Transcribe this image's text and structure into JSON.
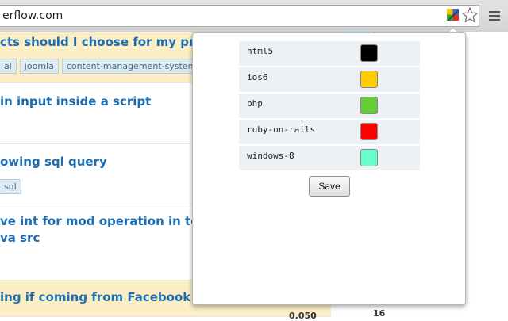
{
  "browser": {
    "url": "erflow.com"
  },
  "questions": [
    {
      "title": "cts should I choose for my proje",
      "tags": [
        "al",
        "joomla",
        "content-management-system"
      ]
    },
    {
      "title": "in input inside a script",
      "tags": []
    },
    {
      "title": "owing sql query",
      "tags": [
        "sql"
      ]
    },
    {
      "title_lines": [
        "ve int for mod operation in toSt",
        "va src"
      ],
      "tags": []
    },
    {
      "title": "ing if coming from Facebook",
      "meta": "0.050"
    }
  ],
  "sidebar": {
    "snippet": "16"
  },
  "popup": {
    "rows": [
      {
        "tag": "html5",
        "color": "#000000"
      },
      {
        "tag": "ios6",
        "color": "#ffcc00"
      },
      {
        "tag": "php",
        "color": "#66cc33"
      },
      {
        "tag": "ruby-on-rails",
        "color": "#ff0000"
      },
      {
        "tag": "windows-8",
        "color": "#66ffcc"
      }
    ],
    "save_label": "Save"
  },
  "icons": {
    "extension": "color-tag-extension-icon",
    "star": "bookmark-star-icon",
    "wrench": "menu-icon"
  }
}
